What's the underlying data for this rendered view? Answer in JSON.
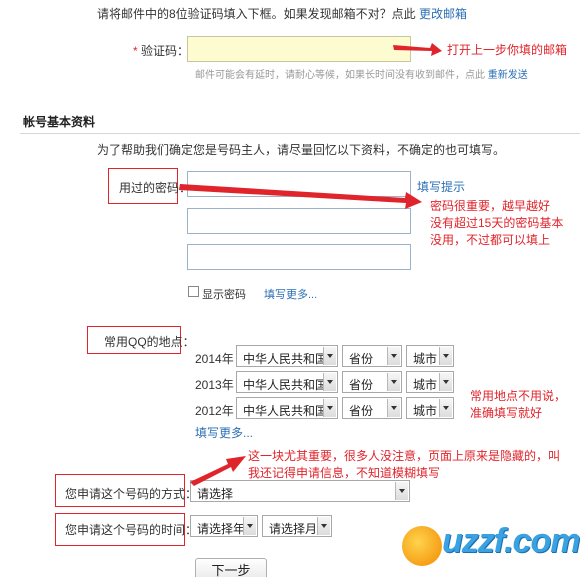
{
  "top_text": "请将邮件中的8位验证码填入下框。如果发现邮箱不对？点此",
  "top_link": "更改邮箱",
  "verify": {
    "required": "*",
    "label": "验证码：",
    "hint": "邮件可能会有延时，请耐心等候，如果长时间没有收到邮件，点此",
    "resend": "重新发送"
  },
  "section": {
    "title": "帐号基本资料",
    "intro": "为了帮助我们确定您是号码主人，请尽量回忆以下资料，不确定的也可填写。"
  },
  "password": {
    "label": "用过的密码：",
    "hint_link": "填写提示",
    "show_label": "显示密码",
    "more": "填写更多..."
  },
  "location": {
    "label": "常用QQ的地点：",
    "rows": [
      {
        "year": "2014年",
        "country": "中华人民共和国",
        "province": "省份",
        "city": "城市"
      },
      {
        "year": "2013年",
        "country": "中华人民共和国",
        "province": "省份",
        "city": "城市"
      },
      {
        "year": "2012年",
        "country": "中华人民共和国",
        "province": "省份",
        "city": "城市"
      }
    ],
    "more": "填写更多..."
  },
  "apply_method": {
    "label": "您申请这个号码的方式：",
    "value": "请选择"
  },
  "apply_time": {
    "label": "您申请这个号码的时间：",
    "year": "请选择年",
    "month": "请选择月"
  },
  "next_button": "下一步",
  "annotations": {
    "a1": "打开上一步你填的邮箱",
    "a2": "密码很重要，越早越好\n没有超过15天的密码基本\n没用，不过都可以填上",
    "a3": "常用地点不用说，\n准确填写就好",
    "a4": "这一块尤其重要，很多人没注意，页面上原来是隐藏的，叫\n我还记得申请信息，不知道模糊填写"
  },
  "watermark": "uzzf.com",
  "colors": {
    "annotation": "#e0242b",
    "link": "#2b6fb6"
  }
}
